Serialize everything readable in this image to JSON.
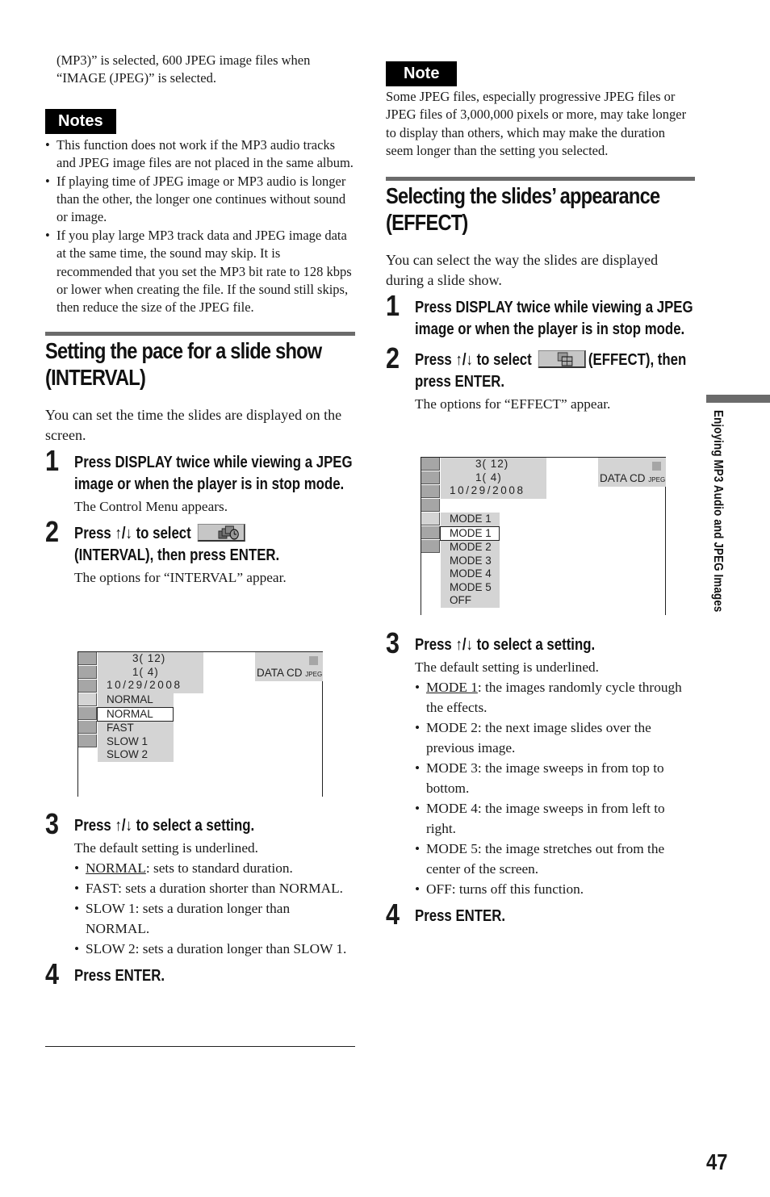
{
  "left": {
    "intro_continuation": "(MP3)” is selected, 600 JPEG image files when “IMAGE (JPEG)” is selected.",
    "notes_label": "Notes",
    "notes": [
      "This function does not work if the MP3 audio tracks and JPEG image files are not placed in the same album.",
      "If playing time of JPEG image or MP3 audio is longer than the other, the longer one continues without sound or image.",
      "If you play large MP3 track data and JPEG image data at the same time, the sound may skip. It is recommended that you set the MP3 bit rate to 128 kbps or lower when creating the file. If the sound still skips, then reduce the size of the JPEG file."
    ],
    "section_title_line1": "Setting the pace for a slide show",
    "section_title_line2": "(INTERVAL)",
    "section_intro": "You can set the time the slides are displayed on the screen.",
    "steps": [
      {
        "num": "1",
        "head": "Press DISPLAY twice while viewing a JPEG image or when the player is in stop mode.",
        "desc": "The Control Menu appears."
      },
      {
        "num": "2",
        "head_before": "Press ↑/↓ to select",
        "head_after": "(INTERVAL), then press ENTER.",
        "icon": "interval-icon",
        "desc": "The options for “INTERVAL” appear."
      },
      {
        "num": "3",
        "head": "Press ↑/↓ to select a setting.",
        "desc": "The default setting is underlined."
      },
      {
        "num": "4",
        "head": "Press ENTER."
      }
    ],
    "osd": {
      "info_lines": [
        "3(   12)",
        "1(      4)",
        "10/29/2008"
      ],
      "disc_label": "DATA CD",
      "disc_sub": "JPEG",
      "current": "NORMAL",
      "options": [
        "NORMAL",
        "FAST",
        "SLOW 1",
        "SLOW 2"
      ],
      "selected": "NORMAL"
    },
    "settings": [
      {
        "name": "NORMAL",
        "underlined": true,
        "text": ": sets to standard duration."
      },
      {
        "name": "FAST",
        "underlined": false,
        "text": ": sets a duration shorter than NORMAL."
      },
      {
        "name": "SLOW 1",
        "underlined": false,
        "text": ": sets a duration longer than NORMAL."
      },
      {
        "name": "SLOW 2",
        "underlined": false,
        "text": ": sets a duration longer than SLOW 1."
      }
    ]
  },
  "right": {
    "note_label": "Note",
    "note_text": "Some JPEG files, especially progressive JPEG files or JPEG files of 3,000,000 pixels or more, may take longer to display than others, which may make the duration seem longer than the setting you selected.",
    "section_title_line1": "Selecting the slides’ appearance",
    "section_title_line2": "(EFFECT)",
    "section_intro": "You can select the way the slides are displayed during a slide show.",
    "steps": [
      {
        "num": "1",
        "head": "Press DISPLAY twice while viewing a JPEG image or when the player is in stop mode."
      },
      {
        "num": "2",
        "head_before": "Press ↑/↓ to select",
        "head_after": "(EFFECT), then press ENTER.",
        "icon": "effect-icon",
        "desc": "The options for “EFFECT” appear."
      },
      {
        "num": "3",
        "head": "Press ↑/↓ to select a setting.",
        "desc": "The default setting is underlined."
      },
      {
        "num": "4",
        "head": "Press ENTER."
      }
    ],
    "osd": {
      "info_lines": [
        "3(   12)",
        "1(      4)",
        "10/29/2008"
      ],
      "disc_label": "DATA CD",
      "disc_sub": "JPEG",
      "current": "MODE 1",
      "options": [
        "MODE 1",
        "MODE 2",
        "MODE 3",
        "MODE 4",
        "MODE 5",
        "OFF"
      ],
      "selected": "MODE 1"
    },
    "settings": [
      {
        "name": "MODE 1",
        "underlined": true,
        "text": ": the images randomly cycle through the effects."
      },
      {
        "name": "MODE 2",
        "underlined": false,
        "text": ": the next image slides over the previous image."
      },
      {
        "name": "MODE 3",
        "underlined": false,
        "text": ": the image sweeps in from top to bottom."
      },
      {
        "name": "MODE 4",
        "underlined": false,
        "text": ": the image sweeps in from left to right."
      },
      {
        "name": "MODE 5",
        "underlined": false,
        "text": ": the image stretches out from the center of the screen."
      },
      {
        "name": "OFF",
        "underlined": false,
        "text": ": turns off this function."
      }
    ]
  },
  "side_tab_text": "Enjoying MP3 Audio and JPEG Images",
  "page_number": "47"
}
